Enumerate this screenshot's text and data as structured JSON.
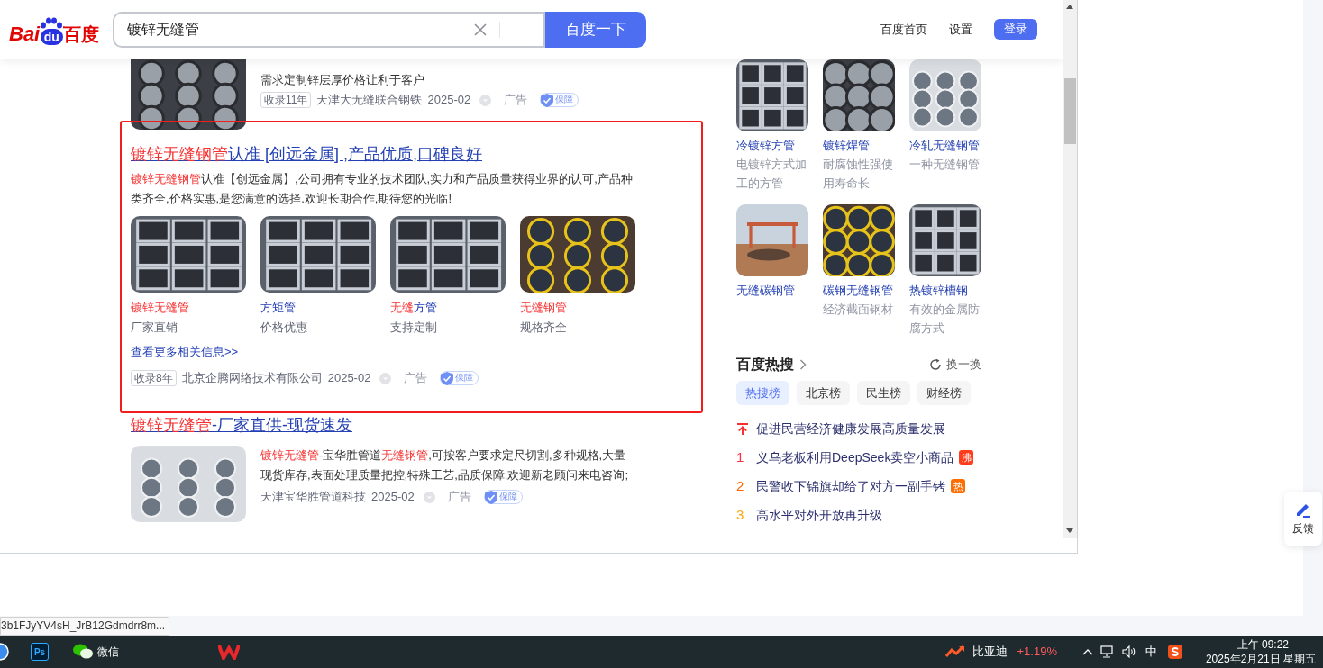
{
  "header": {
    "logo_left": "Bai",
    "logo_badge": "du",
    "logo_right": "百度",
    "search_value": "镀锌无缝管",
    "search_button": "百度一下",
    "links": [
      "百度首页",
      "设置"
    ],
    "login": "登录"
  },
  "results": [
    {
      "kind": "compact",
      "desc": [
        {
          "text": "需求定制锌层厚价格让利于客户",
          "hit": false
        }
      ],
      "meta": {
        "badge": "收录11年",
        "source": "天津大无缝联合钢铁",
        "date": "2025-02",
        "ad": "广告",
        "guarantee": "保障"
      }
    },
    {
      "kind": "gallery",
      "highlighted": true,
      "title": [
        {
          "text": "镀锌无缝钢管",
          "hit": true
        },
        {
          "text": "认准 [创远金属] ,产品优质,口碑良好",
          "hit": false
        }
      ],
      "desc": [
        {
          "text": "镀锌无缝钢管",
          "hit": true
        },
        {
          "text": "认准【创远金属】,公司拥有专业的技术团队,实力和产品质量获得业界的认可,产品种类齐全,价格实惠,是您满意的选择.欢迎长期合作,期待您的光临!",
          "hit": false
        }
      ],
      "gallery": [
        {
          "title": [
            {
              "text": "镀锌无缝管",
              "hit": true
            }
          ],
          "sub": "厂家直销"
        },
        {
          "title": [
            {
              "text": "方矩管",
              "hit": false
            }
          ],
          "sub": "价格优惠"
        },
        {
          "title": [
            {
              "text": "无缝",
              "hit": true
            },
            {
              "text": "方管",
              "hit": false
            }
          ],
          "sub": "支持定制"
        },
        {
          "title": [
            {
              "text": "无缝钢管",
              "hit": true
            }
          ],
          "sub": "规格齐全"
        }
      ],
      "more": "查看更多相关信息>>",
      "meta": {
        "badge": "收录8年",
        "source": "北京企腾网络技术有限公司",
        "date": "2025-02",
        "ad": "广告",
        "guarantee": "保障"
      }
    },
    {
      "kind": "standard",
      "highlighted": false,
      "title": [
        {
          "text": "镀锌无缝管",
          "hit": true
        },
        {
          "text": "-厂家直供-现货速发",
          "hit": false
        }
      ],
      "desc": [
        {
          "text": "镀锌无缝管",
          "hit": true
        },
        {
          "text": "-宝华胜管道",
          "hit": false
        },
        {
          "text": "无缝钢管",
          "hit": true
        },
        {
          "text": ",可按客户要求定尺切割,多种规格,大量现货库存,表面处理质量把控,特殊工艺,品质保障,欢迎新老顾问来电咨询;",
          "hit": false
        }
      ],
      "meta": {
        "source": "天津宝华胜管道科技",
        "date": "2025-02",
        "ad": "广告",
        "guarantee": "保障"
      }
    }
  ],
  "related": [
    {
      "title": "冷镀锌方管",
      "sub": "电镀锌方式加工的方管"
    },
    {
      "title": "镀锌焊管",
      "sub": "耐腐蚀性强使用寿命长"
    },
    {
      "title": "冷轧无缝钢管",
      "sub": "一种无缝钢管"
    },
    {
      "title": "无缝碳钢管"
    },
    {
      "title": "碳钢无缝钢管",
      "sub": "经济截面钢材"
    },
    {
      "title": "热镀锌槽钢",
      "sub": "有效的金属防腐方式"
    }
  ],
  "hot_search": {
    "title": "百度热搜",
    "refresh": "换一换",
    "tabs": [
      {
        "label": "热搜榜",
        "selected": true
      },
      {
        "label": "北京榜",
        "selected": false
      },
      {
        "label": "民生榜",
        "selected": false
      },
      {
        "label": "财经榜",
        "selected": false
      }
    ],
    "items": [
      {
        "kind": "pinned",
        "color": "#f73131",
        "text": "促进民营经济健康发展高质量发展"
      },
      {
        "kind": "ranked",
        "rank": "1",
        "color": "#fe2d46",
        "text": "义乌老板利用DeepSeek卖空小商品",
        "tag": {
          "text": "沸",
          "color": "#ff3d1c"
        }
      },
      {
        "kind": "ranked",
        "rank": "2",
        "color": "#ff6600",
        "text": "民警收下锦旗却给了对方一副手铐",
        "tag": {
          "text": "热",
          "color": "#ff6d00"
        }
      },
      {
        "kind": "ranked",
        "rank": "3",
        "color": "#faa90e",
        "text": "高水平对外开放再升级"
      }
    ]
  },
  "feedback": "反馈",
  "status_url": "3b1FJyYV4sH_JrB12Gdmdrr8m...",
  "taskbar": {
    "apps": [
      {
        "kind": "browser"
      },
      {
        "kind": "ps",
        "label": "Ps"
      },
      {
        "kind": "wechat",
        "label": "微信"
      },
      {
        "kind": "wps"
      }
    ],
    "stock_name": "比亚迪",
    "stock_change": "+1.19%",
    "ime": "中",
    "time": "上午 09:22",
    "date": "2025年2月21日 星期五"
  }
}
